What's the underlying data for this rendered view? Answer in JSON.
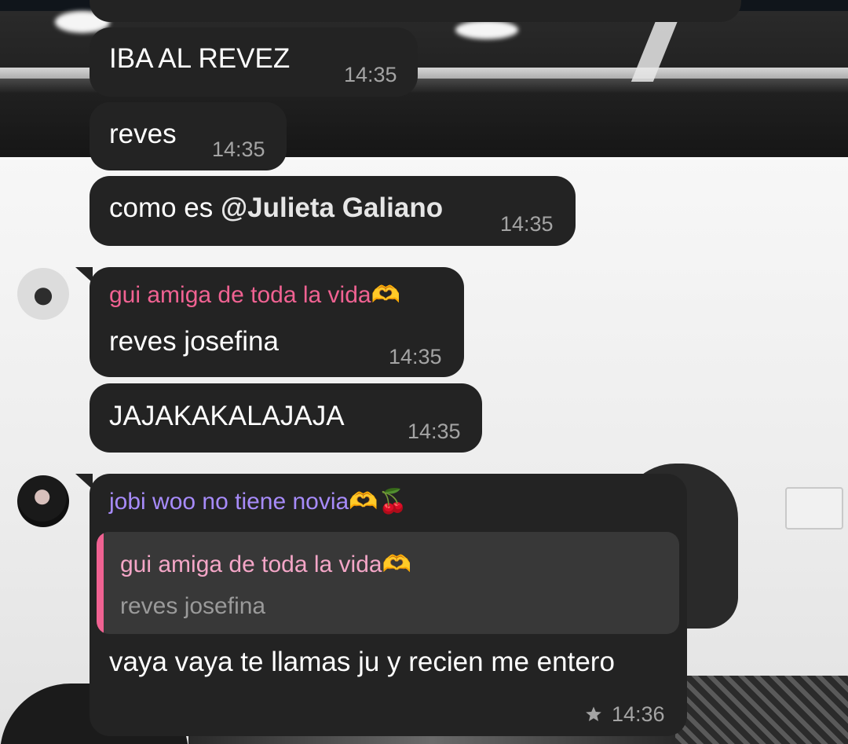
{
  "messages": [
    {
      "text": "IBA AL REVEZ",
      "time": "14:35"
    },
    {
      "text": "reves",
      "time": "14:35"
    },
    {
      "text_prefix": "como es ",
      "mention": "@Julieta Galiano",
      "time": "14:35"
    },
    {
      "sender": "gui amiga de toda la vida",
      "sender_emoji": "🫶",
      "text": "reves josefina",
      "time": "14:35"
    },
    {
      "text": "JAJAKAKALAJAJA",
      "time": "14:35"
    },
    {
      "sender": "jobi woo no tiene novia",
      "sender_emoji": "🫶🍒",
      "reply": {
        "sender": "gui amiga de toda la vida",
        "sender_emoji": "🫶",
        "text": "reves josefina"
      },
      "text": "vaya vaya te llamas ju y recien me entero",
      "time": "14:36"
    }
  ],
  "colors": {
    "bubble_bg": "#232323",
    "timestamp": "#a4a4a4",
    "sender_pink": "#f06292",
    "sender_purple": "#a78bfa",
    "reply_bar": "#f06292",
    "reply_sender": "#f4a6c7",
    "reply_text": "#9a9a9a"
  },
  "icons": {
    "star": "star-icon"
  }
}
